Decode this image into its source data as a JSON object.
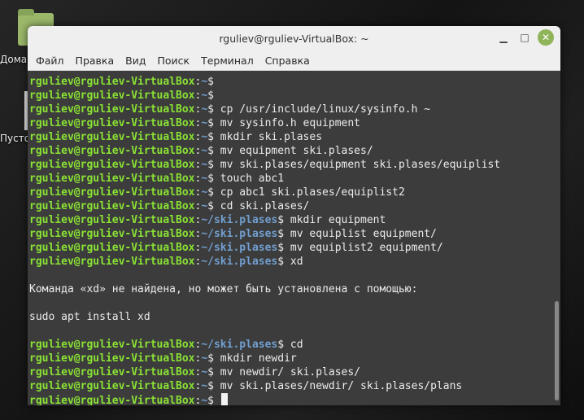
{
  "desktop": {
    "label_1": "Домаш",
    "label_2": "Пустой"
  },
  "window": {
    "title": "rguliev@rguliev-VirtualBox: ~",
    "buttons": {
      "minimize": "▁",
      "maximize": "□",
      "close": "✕"
    }
  },
  "menu": [
    "Файл",
    "Правка",
    "Вид",
    "Поиск",
    "Терминал",
    "Справка"
  ],
  "terminal": {
    "user": "rguliev@rguliev-VirtualBox",
    "lines": [
      {
        "path": "~",
        "cmd": ""
      },
      {
        "path": "~",
        "cmd": ""
      },
      {
        "path": "~",
        "cmd": " cp /usr/include/linux/sysinfo.h ~"
      },
      {
        "path": "~",
        "cmd": " mv sysinfo.h equipment"
      },
      {
        "path": "~",
        "cmd": " mkdir ski.plases"
      },
      {
        "path": "~",
        "cmd": " mv equipment ski.plases/"
      },
      {
        "path": "~",
        "cmd": " mv ski.plases/equipment ski.plases/equiplist"
      },
      {
        "path": "~",
        "cmd": " touch abc1"
      },
      {
        "path": "~",
        "cmd": " cp abc1 ski.plases/equiplist2"
      },
      {
        "path": "~",
        "cmd": " cd ski.plases/"
      },
      {
        "path": "~/ski.plases",
        "cmd": " mkdir equipment"
      },
      {
        "path": "~/ski.plases",
        "cmd": " mv equiplist equipment/"
      },
      {
        "path": "~/ski.plases",
        "cmd": " mv equiplist2 equipment/"
      },
      {
        "path": "~/ski.plases",
        "cmd": " xd"
      },
      {
        "text": ""
      },
      {
        "text": "Команда «xd» не найдена, но может быть установлена с помощью:"
      },
      {
        "text": ""
      },
      {
        "text": "sudo apt install xd"
      },
      {
        "text": ""
      },
      {
        "path": "~/ski.plases",
        "cmd": " cd"
      },
      {
        "path": "~",
        "cmd": " mkdir newdir"
      },
      {
        "path": "~",
        "cmd": " mv newdir/ ski.plases/"
      },
      {
        "path": "~",
        "cmd": " mv ski.plases/newdir/ ski.plases/plans"
      },
      {
        "path": "~",
        "cmd": " ",
        "cursor": true
      }
    ]
  },
  "colors": {
    "user": "#8ae234",
    "path": "#729fcf",
    "background": "#3c3c3c",
    "close_button": "#8fb45a"
  }
}
